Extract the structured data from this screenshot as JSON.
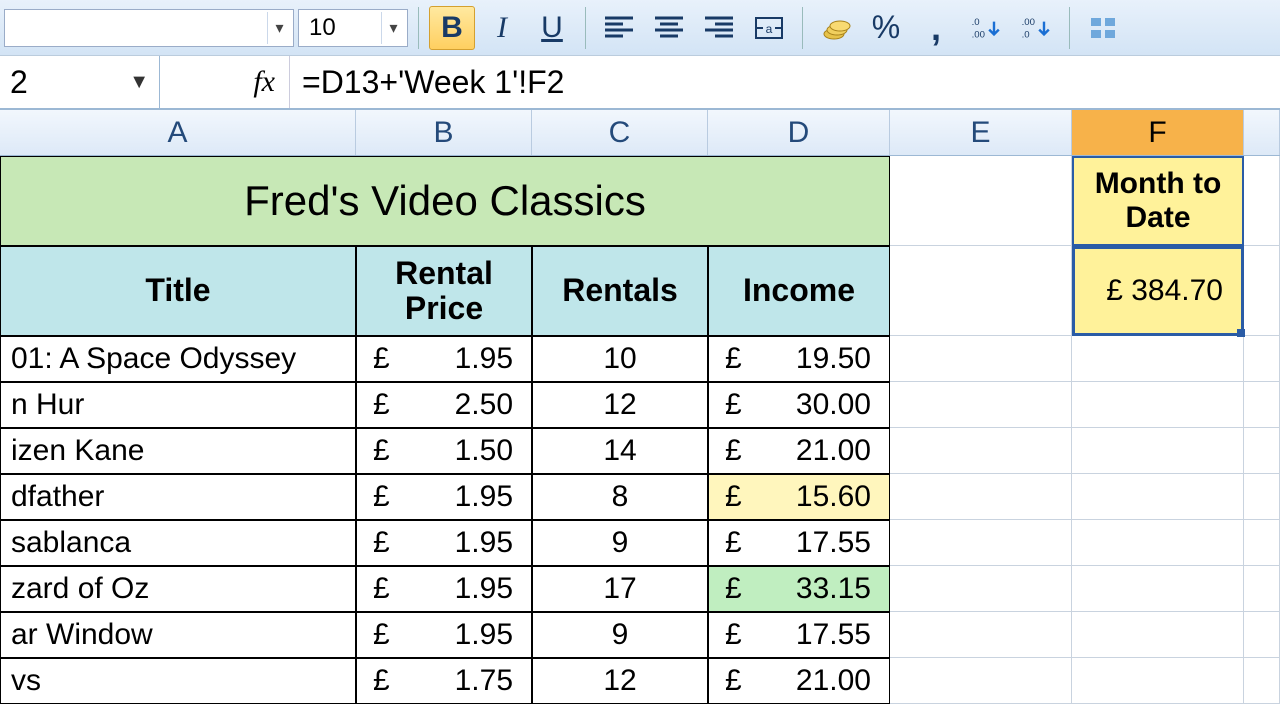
{
  "toolbar": {
    "font_size": "10",
    "bold": "B",
    "italic": "I",
    "underline": "U",
    "percent": "%",
    "comma": ","
  },
  "formula": {
    "cell_ref": "2",
    "fx_label": "fx",
    "formula": "=D13+'Week 1'!F2"
  },
  "columns": {
    "A": "A",
    "B": "B",
    "C": "C",
    "D": "D",
    "E": "E",
    "F": "F"
  },
  "title": "Fred's Video Classics",
  "headers": {
    "title": "Title",
    "price": "Rental Price",
    "rentals": "Rentals",
    "income": "Income"
  },
  "mtd": {
    "label": "Month to Date",
    "sym": "£",
    "value": "384.70"
  },
  "rows": [
    {
      "title": "01: A Space Odyssey",
      "psym": "£",
      "price": "1.95",
      "rentals": "10",
      "isym": "£",
      "income": "19.50",
      "hl": ""
    },
    {
      "title": "n Hur",
      "psym": "£",
      "price": "2.50",
      "rentals": "12",
      "isym": "£",
      "income": "30.00",
      "hl": ""
    },
    {
      "title": "izen Kane",
      "psym": "£",
      "price": "1.50",
      "rentals": "14",
      "isym": "£",
      "income": "21.00",
      "hl": ""
    },
    {
      "title": "dfather",
      "psym": "£",
      "price": "1.95",
      "rentals": "8",
      "isym": "£",
      "income": "15.60",
      "hl": "yellow"
    },
    {
      "title": "sablanca",
      "psym": "£",
      "price": "1.95",
      "rentals": "9",
      "isym": "£",
      "income": "17.55",
      "hl": ""
    },
    {
      "title": "zard of Oz",
      "psym": "£",
      "price": "1.95",
      "rentals": "17",
      "isym": "£",
      "income": "33.15",
      "hl": "green"
    },
    {
      "title": "ar Window",
      "psym": "£",
      "price": "1.95",
      "rentals": "9",
      "isym": "£",
      "income": "17.55",
      "hl": ""
    },
    {
      "title": "vs",
      "psym": "£",
      "price": "1.75",
      "rentals": "12",
      "isym": "£",
      "income": "21.00",
      "hl": ""
    }
  ]
}
